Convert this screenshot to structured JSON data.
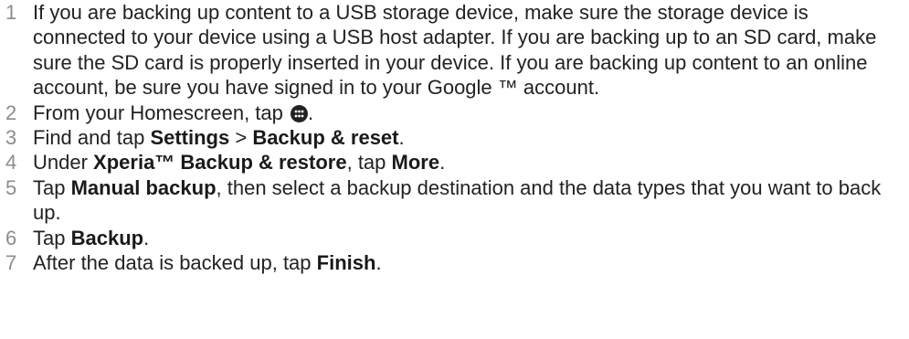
{
  "steps": [
    {
      "num": "1",
      "text": "If you are backing up content to a USB storage device, make sure the storage device is connected to your device using a USB host adapter. If you are backing up to an SD card, make sure the SD card is properly inserted in your device. If you are backing up content to an online account, be sure you have signed in to your Google ™ account."
    },
    {
      "num": "2",
      "prefix": "From your Homescreen, tap ",
      "icon": "apps-icon",
      "suffix": "."
    },
    {
      "num": "3",
      "prefix": "Find and tap ",
      "bold1": "Settings",
      "mid": " > ",
      "bold2": "Backup & reset",
      "suffix": "."
    },
    {
      "num": "4",
      "prefix": "Under ",
      "bold1": "Xperia™ Backup & restore",
      "mid": ", tap ",
      "bold2": "More",
      "suffix": "."
    },
    {
      "num": "5",
      "prefix": "Tap ",
      "bold1": "Manual backup",
      "suffix": ", then select a backup destination and the data types that you want to back up."
    },
    {
      "num": "6",
      "prefix": "Tap ",
      "bold1": "Backup",
      "suffix": "."
    },
    {
      "num": "7",
      "prefix": "After the data is backed up, tap ",
      "bold1": "Finish",
      "suffix": "."
    }
  ]
}
